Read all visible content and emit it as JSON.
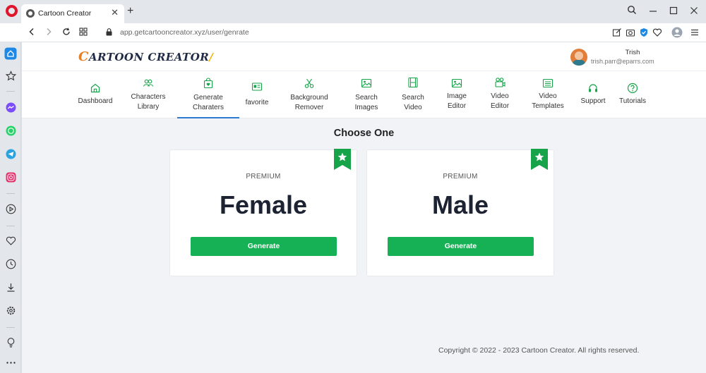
{
  "browser": {
    "tab_title": "Cartoon Creator",
    "tab_close": "✕",
    "new_tab": "+",
    "url": "app.getcartooncreator.xyz/user/genrate",
    "window_controls": [
      "search-icon",
      "minimize-icon",
      "maximize-icon",
      "close-icon"
    ],
    "sidebar_icons": [
      "home-icon",
      "star-icon",
      "messenger-icon",
      "whatsapp-icon",
      "telegram-icon",
      "instagram-icon",
      "player-icon",
      "heart-icon",
      "history-icon",
      "download-icon",
      "settings-icon",
      "lightbulb-icon",
      "more-icon"
    ],
    "colors": {
      "opera_red": "#e0152b",
      "sidebar_active": "#1e88e5"
    }
  },
  "header": {
    "logo_text": "ARTOON CREATOR",
    "logo_initial": "C",
    "user_name": "Trish",
    "user_email": "trish.parr@eparrs.com"
  },
  "menu": {
    "items": [
      {
        "label1": "Dashboard",
        "label2": "",
        "icon": "home-icon"
      },
      {
        "label1": "Characters",
        "label2": "Library",
        "icon": "users-icon"
      },
      {
        "label1": "Generate",
        "label2": "Charaters",
        "icon": "shopping-bag-heart-icon"
      },
      {
        "label1": "favorite",
        "label2": "",
        "icon": "id-card-icon"
      },
      {
        "label1": "Background",
        "label2": "Remover",
        "icon": "scissors-icon"
      },
      {
        "label1": "Search",
        "label2": "Images",
        "icon": "image-icon"
      },
      {
        "label1": "Search",
        "label2": "Video",
        "icon": "film-icon"
      },
      {
        "label1": "Image",
        "label2": "Editor",
        "icon": "image-icon"
      },
      {
        "label1": "Video",
        "label2": "Editor",
        "icon": "video-camera-icon"
      },
      {
        "label1": "Video",
        "label2": "Templates",
        "icon": "list-box-icon"
      },
      {
        "label1": "Support",
        "label2": "",
        "icon": "headset-icon"
      },
      {
        "label1": "Tutorials",
        "label2": "",
        "icon": "question-circle-icon"
      }
    ],
    "active_item": "Generate Charaters",
    "colors": {
      "icon": "#16a34a",
      "active_underline": "#2e7bcf"
    }
  },
  "main": {
    "title": "Choose One",
    "cards": [
      {
        "tier": "PREMIUM",
        "title": "Female",
        "button": "Generate",
        "badge": "star-ribbon-icon"
      },
      {
        "tier": "PREMIUM",
        "title": "Male",
        "button": "Generate",
        "badge": "star-ribbon-icon"
      }
    ],
    "colors": {
      "button": "#16b155",
      "ribbon": "#16a34a"
    }
  },
  "footer": {
    "copyright": "Copyright © 2022 - 2023 Cartoon Creator. All rights reserved."
  }
}
